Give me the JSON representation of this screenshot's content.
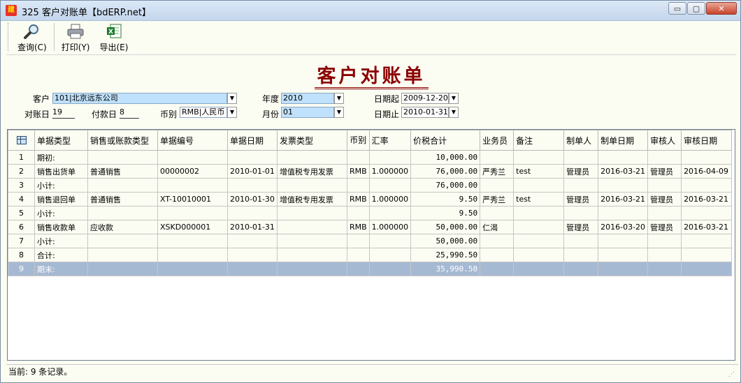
{
  "window": {
    "title": "325 客户对账单【bdERP.net】",
    "app_icon_text": "建",
    "buttons": [
      "▭",
      "▢",
      "✕"
    ]
  },
  "toolbar": [
    {
      "label": "查询(C)",
      "icon": "magnifier-icon"
    },
    {
      "label": "打印(Y)",
      "icon": "printer-icon"
    },
    {
      "label": "导出(E)",
      "icon": "excel-icon"
    }
  ],
  "report_title": "客户对账单",
  "form": {
    "customer_label": "客户",
    "customer_value": "101|北京远东公司",
    "year_label": "年度",
    "year_value": "2010",
    "date_from_label": "日期起",
    "date_from_value": "2009-12-20",
    "statement_day_label": "对账日",
    "statement_day_value": "19",
    "payment_day_label": "付款日",
    "payment_day_value": "8",
    "currency_label": "币别",
    "currency_value": "RMB|人民币",
    "month_label": "月份",
    "month_value": "01",
    "date_to_label": "日期止",
    "date_to_value": "2010-01-31"
  },
  "grid": {
    "columns": [
      "单据类型",
      "销售或账款类型",
      "单据编号",
      "单据日期",
      "发票类型",
      "币别",
      "汇率",
      "价税合计",
      "业务员",
      "备注",
      "制单人",
      "制单日期",
      "审核人",
      "审核日期"
    ],
    "rows": [
      [
        "1",
        "期初:",
        "",
        "",
        "",
        "",
        "",
        "",
        "10,000.00",
        "",
        "",
        "",
        "",
        "",
        ""
      ],
      [
        "2",
        "销售出货单",
        "普通销售",
        "00000002",
        "2010-01-01",
        "增值税专用发票",
        "RMB",
        "1.000000",
        "76,000.00",
        "严秀兰",
        "test",
        "管理员",
        "2016-03-21",
        "管理员",
        "2016-04-09"
      ],
      [
        "3",
        "小计:",
        "",
        "",
        "",
        "",
        "",
        "",
        "76,000.00",
        "",
        "",
        "",
        "",
        "",
        ""
      ],
      [
        "4",
        "销售退回单",
        "普通销售",
        "XT-10010001",
        "2010-01-30",
        "增值税专用发票",
        "RMB",
        "1.000000",
        "9.50",
        "严秀兰",
        "test",
        "管理员",
        "2016-03-21",
        "管理员",
        "2016-03-21"
      ],
      [
        "5",
        "小计:",
        "",
        "",
        "",
        "",
        "",
        "",
        "9.50",
        "",
        "",
        "",
        "",
        "",
        ""
      ],
      [
        "6",
        "销售收款单",
        "应收款",
        "XSKD000001",
        "2010-01-31",
        "",
        "RMB",
        "1.000000",
        "50,000.00",
        "仁渴",
        "",
        "管理员",
        "2016-03-20",
        "管理员",
        "2016-03-21"
      ],
      [
        "7",
        "小计:",
        "",
        "",
        "",
        "",
        "",
        "",
        "50,000.00",
        "",
        "",
        "",
        "",
        "",
        ""
      ],
      [
        "8",
        "合计:",
        "",
        "",
        "",
        "",
        "",
        "",
        "25,990.50",
        "",
        "",
        "",
        "",
        "",
        ""
      ],
      [
        "9",
        "期末:",
        "",
        "",
        "",
        "",
        "",
        "",
        "35,990.50",
        "",
        "",
        "",
        "",
        "",
        ""
      ]
    ],
    "selected_row": 8
  },
  "status": "当前: 9 条记录。",
  "dropdown_glyph": "▼"
}
